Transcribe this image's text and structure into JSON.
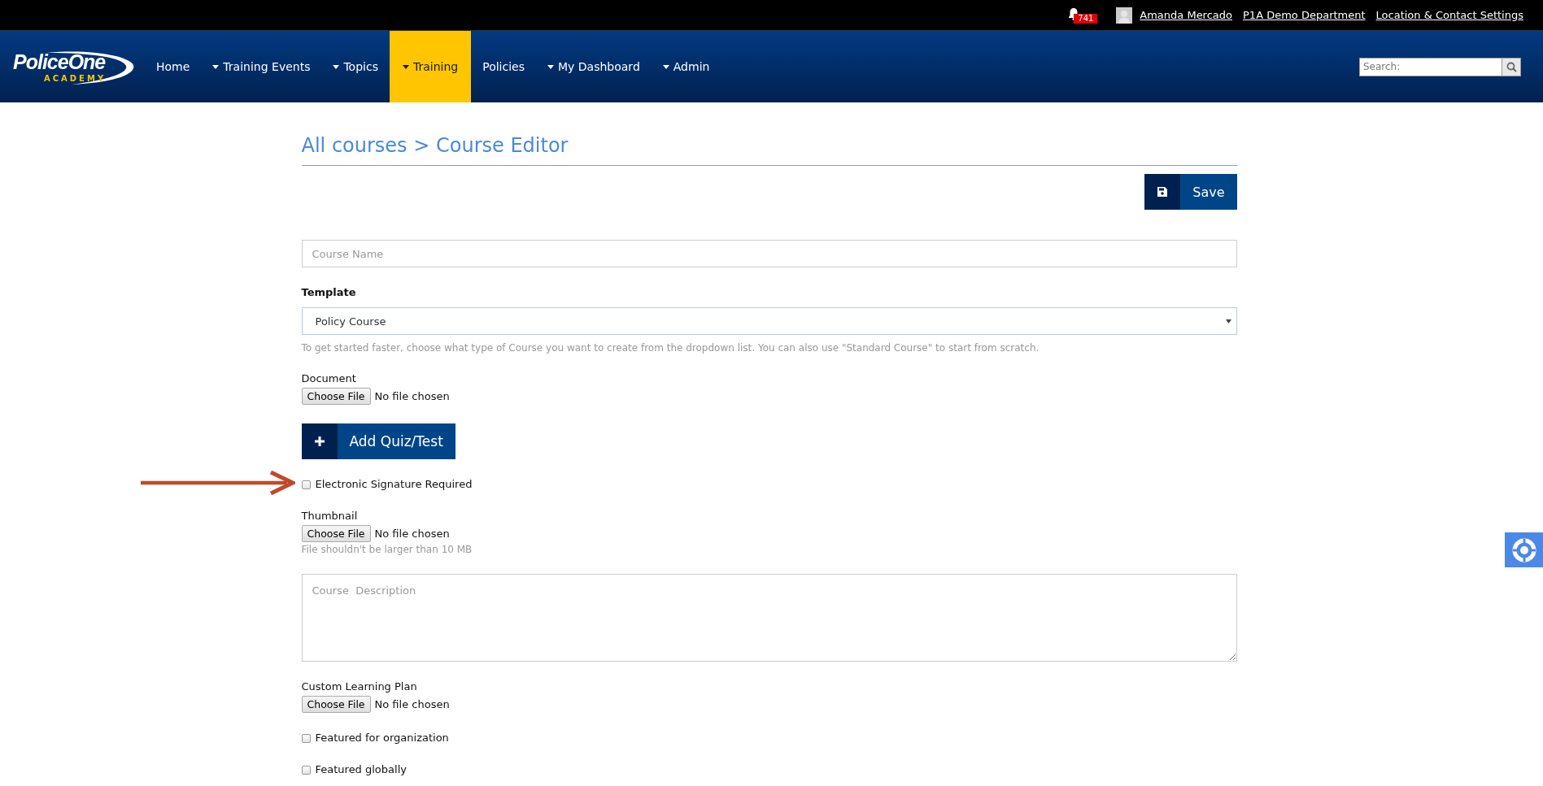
{
  "top_bar": {
    "notification_count": "741",
    "user_name": "Amanda Mercado",
    "department": "P1A Demo Department",
    "settings_link": "Location & Contact Settings"
  },
  "logo": {
    "name": "PoliceOne",
    "subtitle": "ACADEMY"
  },
  "nav": [
    {
      "label": "Home",
      "dropdown": false,
      "selected": false
    },
    {
      "label": "Training Events",
      "dropdown": true,
      "selected": false
    },
    {
      "label": "Topics",
      "dropdown": true,
      "selected": false
    },
    {
      "label": "Training",
      "dropdown": true,
      "selected": true
    },
    {
      "label": "Policies",
      "dropdown": false,
      "selected": false
    },
    {
      "label": "My Dashboard",
      "dropdown": true,
      "selected": false
    },
    {
      "label": "Admin",
      "dropdown": true,
      "selected": false
    }
  ],
  "search": {
    "placeholder": "Search:"
  },
  "page_title": "All courses > Course Editor",
  "save_button": "Save",
  "fields": [
    {
      "kind": "text",
      "placeholder": "Course Name"
    },
    {
      "kind": "select",
      "label": "Template",
      "value": "Policy Course",
      "hint": "To get started faster, choose what type of Course you want to create from the dropdown list. You can also use \"Standard Course\" to start from scratch."
    },
    {
      "kind": "file",
      "label": "Document",
      "button": "Choose File",
      "status": "No file chosen"
    },
    {
      "kind": "action",
      "label": "Add Quiz/Test"
    },
    {
      "kind": "checkbox",
      "label": "Electronic Signature Required",
      "checked": false,
      "pointer": true
    },
    {
      "kind": "file",
      "label": "Thumbnail",
      "button": "Choose File",
      "status": "No file chosen",
      "hint": "File shouldn't be larger than 10 MB"
    },
    {
      "kind": "textarea",
      "placeholder": "Course  Description"
    },
    {
      "kind": "file",
      "label": "Custom Learning Plan",
      "button": "Choose File",
      "status": "No file chosen"
    },
    {
      "kind": "checkbox",
      "label": "Featured for organization",
      "checked": false,
      "pointer": false
    },
    {
      "kind": "checkbox",
      "label": "Featured globally",
      "checked": false,
      "pointer": false
    }
  ]
}
